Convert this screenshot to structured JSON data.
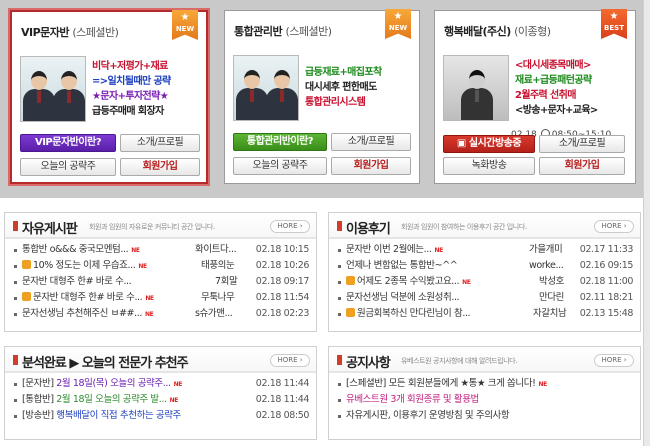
{
  "cards": [
    {
      "title": "VIP문자반",
      "subtitle": "(스페셜반)",
      "tag": "NEW",
      "lines": [
        "비닥+저평가+재료",
        "=>일치될때만 공략",
        "★문자+투자전략★",
        "급등주매매 회장자"
      ],
      "buttons": {
        "intro": "VIP문자반이란?",
        "profile": "소개/프로필",
        "today": "오늘의 공략주",
        "join": "회원가입"
      }
    },
    {
      "title": "통합관리반",
      "subtitle": "(스페셜반)",
      "tag": "NEW",
      "lines": [
        "급등재료+매집포착",
        "대시세후 편한매도",
        "통합관리시스템"
      ],
      "buttons": {
        "intro": "통합관리반이란?",
        "profile": "소개/프로필",
        "today": "오늘의 공략주",
        "join": "회원가입"
      }
    },
    {
      "title": "행복배달(주신)",
      "subtitle": "(이종형)",
      "tag": "BEST",
      "lines": [
        "<대시세종목매매>",
        "재료+급등패턴공략",
        "2월주력 선취매",
        "<방송+문자+교육>"
      ],
      "date": "02.18",
      "time": "08:50~15:10",
      "buttons": {
        "live": "실시간방송중",
        "profile": "소개/프로필",
        "replay": "녹화방송",
        "join": "회원가입"
      }
    }
  ],
  "boards": {
    "free": {
      "title": "자유게시판",
      "desc": "회원과 임원의 자유로운 커뮤니티 공간 입니다.",
      "more": "HORE",
      "rows": [
        {
          "text": "통합반 o&&& 중국모멘텀...",
          "new": "NE",
          "author": "화이트다...",
          "date": "02.18 10:15",
          "pic": false
        },
        {
          "text": "10% 정도는 이제 우습죠...",
          "new": "NE",
          "author": "태풍의눈",
          "date": "02.18 10:26",
          "pic": true
        },
        {
          "text": "문자반 대형주 한# 바로 수...",
          "new": "",
          "author": "7회말",
          "date": "02.18 09:17",
          "pic": false
        },
        {
          "text": "문자반 대형주 한# 바로 수...",
          "new": "NE",
          "author": "무툭나무",
          "date": "02.18 11:54",
          "pic": true
        },
        {
          "text": "문자선생님 추천해주신 ㅂ##...",
          "new": "NE",
          "author": "s슈가맨...",
          "date": "02.18 02:23",
          "pic": false
        }
      ]
    },
    "review": {
      "title": "이용후기",
      "desc": "회원과 임원이 참여하는 이용후기 공간 입니다.",
      "more": "HORE",
      "rows": [
        {
          "text": "문자반 이번 2월에는...",
          "new": "NE",
          "author": "가을개미",
          "date": "02.17 11:33",
          "pic": false
        },
        {
          "text": "언제나 변함없는 통합반~^^",
          "new": "",
          "author": "worke...",
          "date": "02.16 09:15",
          "pic": false
        },
        {
          "text": "어제도 2종목 수익봤고요...",
          "new": "NE",
          "author": "박성호",
          "date": "02.18 11:00",
          "pic": true
        },
        {
          "text": "문자선생님 덕분에 소원성취...",
          "new": "",
          "author": "만다린",
          "date": "02.11 18:21",
          "pic": false
        },
        {
          "text": "원금회복하신 만다린님이 참...",
          "new": "",
          "author": "자갈치남",
          "date": "02.13 15:48",
          "pic": true
        }
      ]
    },
    "analysis": {
      "title": "분석완료 ▶ 오늘의 전문가 추천주",
      "more": "HORE",
      "rows": [
        {
          "prefix": "[문자반]",
          "text": "2월 18일(목) 오늘의 공략주...",
          "new": "NE",
          "date": "02.18 11:44"
        },
        {
          "prefix": "[통합반]",
          "text": "2월 18일 오늘의 공략주 발...",
          "new": "NE",
          "date": "02.18 11:44"
        },
        {
          "prefix": "[방송반]",
          "text": "행복배달이 직접 추천하는 공략주",
          "new": "",
          "date": "02.18 08:50"
        }
      ]
    },
    "notice": {
      "title": "공지사항",
      "desc": "유베스트원 공지사항에 대해 알려드립니다.",
      "more": "HORE",
      "rows": [
        {
          "text": "[스페셜반] 모든 회원분들에게 ★통★ 크게 쏩니다!",
          "new": "NE",
          "color": "#333333"
        },
        {
          "text": "유베스트원 3개 회원종류 및 활용법",
          "new": "",
          "color": "#c02080"
        },
        {
          "text": "자유게시판, 이용후기 운영방침 및 주의사항",
          "new": "",
          "color": "#333333"
        }
      ]
    }
  },
  "colors": {
    "accent_red": "#d33b2a",
    "line_red": "#c8102e",
    "line_blue": "#1c3fbf",
    "line_purple": "#7a1fb3",
    "analysis_green": "#2e8b2e",
    "analysis_purple": "#6a1fb0",
    "analysis_blue": "#1c3fbf"
  }
}
